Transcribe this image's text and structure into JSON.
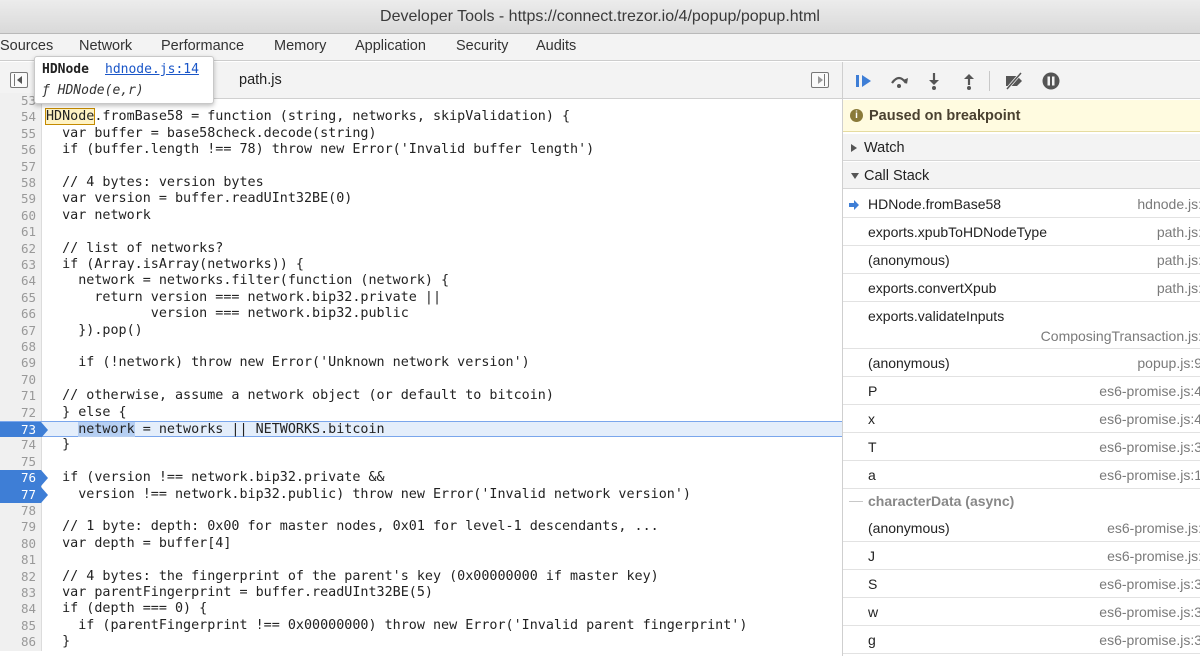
{
  "window": {
    "title": "Developer Tools - https://connect.trezor.io/4/popup/popup.html"
  },
  "panels": [
    "Sources",
    "Network",
    "Performance",
    "Memory",
    "Application",
    "Security",
    "Audits"
  ],
  "editor": {
    "tab_file": "path.js",
    "tooltip": {
      "name": "HDNode",
      "link": "hdnode.js:14",
      "signature": "ƒ HDNode(e,r)"
    },
    "lines": [
      {
        "n": "53",
        "t": ""
      },
      {
        "n": "54",
        "t": "HDNode.fromBase58 = function (string, networks, skipValidation) {"
      },
      {
        "n": "55",
        "t": "  var buffer = base58check.decode(string)"
      },
      {
        "n": "56",
        "t": "  if (buffer.length !== 78) throw new Error('Invalid buffer length')"
      },
      {
        "n": "57",
        "t": ""
      },
      {
        "n": "58",
        "t": "  // 4 bytes: version bytes"
      },
      {
        "n": "59",
        "t": "  var version = buffer.readUInt32BE(0)"
      },
      {
        "n": "60",
        "t": "  var network"
      },
      {
        "n": "61",
        "t": ""
      },
      {
        "n": "62",
        "t": "  // list of networks?"
      },
      {
        "n": "63",
        "t": "  if (Array.isArray(networks)) {"
      },
      {
        "n": "64",
        "t": "    network = networks.filter(function (network) {"
      },
      {
        "n": "65",
        "t": "      return version === network.bip32.private ||"
      },
      {
        "n": "66",
        "t": "             version === network.bip32.public"
      },
      {
        "n": "67",
        "t": "    }).pop()"
      },
      {
        "n": "68",
        "t": ""
      },
      {
        "n": "69",
        "t": "    if (!network) throw new Error('Unknown network version')"
      },
      {
        "n": "70",
        "t": ""
      },
      {
        "n": "71",
        "t": "  // otherwise, assume a network object (or default to bitcoin)"
      },
      {
        "n": "72",
        "t": "  } else {"
      },
      {
        "n": "73",
        "t": "    network = networks || NETWORKS.bitcoin"
      },
      {
        "n": "74",
        "t": "  }"
      },
      {
        "n": "75",
        "t": ""
      },
      {
        "n": "76",
        "t": "  if (version !== network.bip32.private &&"
      },
      {
        "n": "77",
        "t": "    version !== network.bip32.public) throw new Error('Invalid network version')"
      },
      {
        "n": "78",
        "t": ""
      },
      {
        "n": "79",
        "t": "  // 1 byte: depth: 0x00 for master nodes, 0x01 for level-1 descendants, ..."
      },
      {
        "n": "80",
        "t": "  var depth = buffer[4]"
      },
      {
        "n": "81",
        "t": ""
      },
      {
        "n": "82",
        "t": "  // 4 bytes: the fingerprint of the parent's key (0x00000000 if master key)"
      },
      {
        "n": "83",
        "t": "  var parentFingerprint = buffer.readUInt32BE(5)"
      },
      {
        "n": "84",
        "t": "  if (depth === 0) {"
      },
      {
        "n": "85",
        "t": "    if (parentFingerprint !== 0x00000000) throw new Error('Invalid parent fingerprint')"
      },
      {
        "n": "86",
        "t": "  }"
      }
    ]
  },
  "debugger": {
    "paused_text": "Paused on breakpoint",
    "watch_label": "Watch",
    "callstack_label": "Call Stack",
    "frames": [
      {
        "fn": "HDNode.fromBase58",
        "loc": "hdnode.js:",
        "loc2": ""
      },
      {
        "fn": "exports.xpubToHDNodeType",
        "loc": "path.js:",
        "loc2": ""
      },
      {
        "fn": "(anonymous)",
        "loc": "path.js:",
        "loc2": ""
      },
      {
        "fn": "exports.convertXpub",
        "loc": "path.js:",
        "loc2": ""
      },
      {
        "fn": "exports.validateInputs",
        "loc": "",
        "loc2": "ComposingTransaction.js:"
      },
      {
        "fn": "(anonymous)",
        "loc": "popup.js:9",
        "loc2": ""
      },
      {
        "fn": "P",
        "loc": "es6-promise.js:4",
        "loc2": ""
      },
      {
        "fn": "x",
        "loc": "es6-promise.js:4",
        "loc2": ""
      },
      {
        "fn": "T",
        "loc": "es6-promise.js:3",
        "loc2": ""
      },
      {
        "fn": "a",
        "loc": "es6-promise.js:1",
        "loc2": ""
      }
    ],
    "async_label": "characterData (async)",
    "async_frames": [
      {
        "fn": "(anonymous)",
        "loc": "es6-promise.js:",
        "loc2": ""
      },
      {
        "fn": "J",
        "loc": "es6-promise.js:",
        "loc2": ""
      },
      {
        "fn": "S",
        "loc": "es6-promise.js:3",
        "loc2": ""
      },
      {
        "fn": "w",
        "loc": "es6-promise.js:3",
        "loc2": ""
      },
      {
        "fn": "g",
        "loc": "es6-promise.js:3",
        "loc2": ""
      }
    ]
  },
  "colors": {
    "breakpoint": "#3e7ed6",
    "current_line": "#e4eefb",
    "paused_bg": "#fffbe0"
  }
}
